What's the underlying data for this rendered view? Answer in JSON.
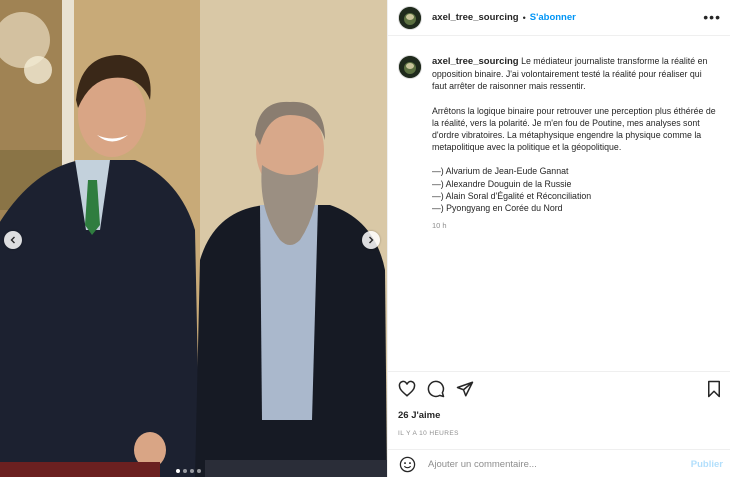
{
  "header": {
    "username": "axel_tree_sourcing",
    "separator": "•",
    "follow_label": "S'abonner",
    "more_label": "•••"
  },
  "caption": {
    "username": "axel_tree_sourcing",
    "paragraph1": "Le médiateur journaliste transforme la réalité en opposition binaire. J'ai volontairement testé la réalité pour réaliser qui faut arrêter de raisonner mais ressentir.",
    "paragraph2": "Arrêtons la logique binaire pour retrouver une perception plus éthérée de la réalité, vers la polarité. Je m'en fou de Poutine, mes analyses sont d'ordre vibratoires. La métaphysique engendre la physique comme la metapolitique avec la politique et la géopolitique.",
    "list": [
      "—) Alvarium de Jean-Eude Gannat",
      "—) Alexandre Douguin de la Russie",
      "—) Alain Soral d'Égalité et Réconciliation",
      "—) Pyongyang en Corée du Nord"
    ],
    "time": "10 h"
  },
  "actions": {
    "likes": "26 J'aime",
    "date": "IL Y A 10 HEURES"
  },
  "comment": {
    "placeholder": "Ajouter un commentaire...",
    "publish_label": "Publier"
  },
  "icons": {
    "like": "heart-icon",
    "comment": "comment-icon",
    "share": "share-icon",
    "save": "bookmark-icon",
    "emoji": "emoji-icon",
    "prev": "chevron-left-icon",
    "next": "chevron-right-icon"
  },
  "carousel": {
    "slide_count": 4,
    "active_slide": 1
  },
  "colors": {
    "accent": "#0095f6",
    "publish_disabled": "#b2dffc",
    "muted": "#8e8e8e"
  }
}
